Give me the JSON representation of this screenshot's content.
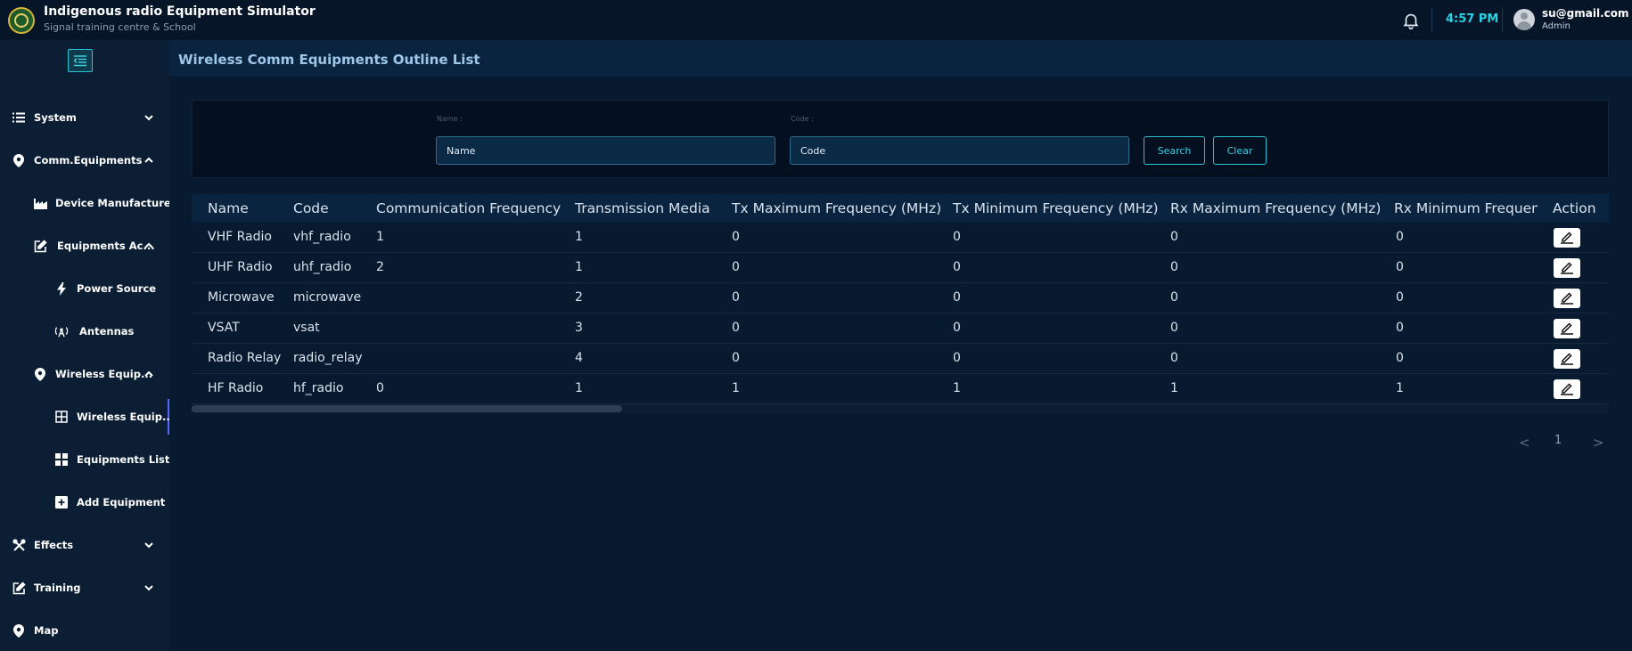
{
  "header": {
    "app_title": "Indigenous radio Equipment Simulator",
    "app_subtitle": "Signal training centre & School",
    "time": "4:57 PM",
    "user_email": "su@gmail.com",
    "user_role": "Admin"
  },
  "sidebar": {
    "items": [
      {
        "label": "System",
        "icon": "list-icon",
        "chevron": "down"
      },
      {
        "label": "Comm.Equipments",
        "icon": "location-pin-icon",
        "chevron": "up"
      },
      {
        "label": "Device Manufacturer",
        "icon": "factory-icon"
      },
      {
        "label": "Equipments Ac...",
        "icon": "edit-icon",
        "chevron": "up"
      },
      {
        "label": "Power Source",
        "icon": "lightning-icon"
      },
      {
        "label": "Antennas",
        "icon": "antenna-icon"
      },
      {
        "label": "Wireless Equip...",
        "icon": "location-pin-icon",
        "chevron": "up"
      },
      {
        "label": "Wireless Equip...",
        "icon": "grid-icon",
        "active": true
      },
      {
        "label": "Equipments List",
        "icon": "grid-fill-icon"
      },
      {
        "label": "Add Equipment",
        "icon": "plus-square-icon"
      },
      {
        "label": "Effects",
        "icon": "tools-icon",
        "chevron": "down"
      },
      {
        "label": "Training",
        "icon": "edit-icon",
        "chevron": "down"
      },
      {
        "label": "Map",
        "icon": "location-pin-icon"
      }
    ]
  },
  "main": {
    "title": "Wireless Comm Equipments Outline List",
    "filters": {
      "name_label": "Name :",
      "name_placeholder": "Name",
      "code_label": "Code :",
      "code_placeholder": "Code",
      "search_label": "Search",
      "clear_label": "Clear"
    },
    "table": {
      "columns": [
        "Name",
        "Code",
        "Communication Frequency",
        "Transmission Media",
        "Tx Maximum Frequency (MHz)",
        "Tx Minimum Frequency (MHz)",
        "Rx Maximum Frequency (MHz)",
        "Rx Minimum Frequency",
        "Action"
      ],
      "rows": [
        [
          "VHF Radio",
          "vhf_radio",
          "1",
          "1",
          "0",
          "0",
          "0",
          "0"
        ],
        [
          "UHF Radio",
          "uhf_radio",
          "2",
          "1",
          "0",
          "0",
          "0",
          "0"
        ],
        [
          "Microwave",
          "microwave",
          "",
          "2",
          "0",
          "0",
          "0",
          "0"
        ],
        [
          "VSAT",
          "vsat",
          "",
          "3",
          "0",
          "0",
          "0",
          "0"
        ],
        [
          "Radio Relay",
          "radio_relay",
          "",
          "4",
          "0",
          "0",
          "0",
          "0"
        ],
        [
          "HF Radio",
          "hf_radio",
          "0",
          "1",
          "1",
          "1",
          "1",
          "1"
        ]
      ]
    },
    "pagination": {
      "prev": "<",
      "current_page": "1",
      "next": ">"
    }
  },
  "colors": {
    "accent": "#29c5d6",
    "clock": "#29d3e6",
    "background": "#061528",
    "sidebar": "#0b1e33",
    "title": "#9fc7ea"
  }
}
